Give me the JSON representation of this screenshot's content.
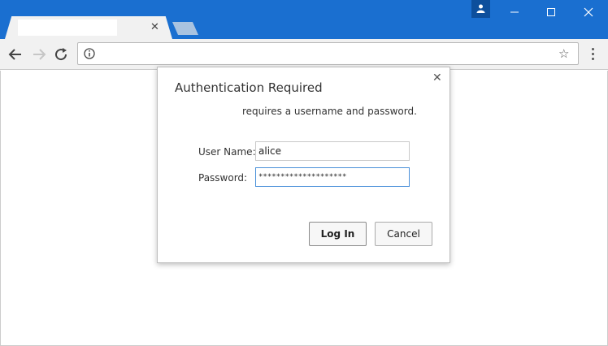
{
  "colors": {
    "titlebar": "#1a6fd0",
    "accent_focus": "#4a90d9"
  },
  "browser": {
    "tab_close_glyph": "✕",
    "bookmark_glyph": "☆"
  },
  "dialog": {
    "title": "Authentication Required",
    "message": "requires a username and password.",
    "close_glyph": "✕",
    "username_label": "User Name:",
    "username_value": "alice",
    "password_label": "Password:",
    "password_value": "********************",
    "login_label": "Log In",
    "cancel_label": "Cancel"
  }
}
